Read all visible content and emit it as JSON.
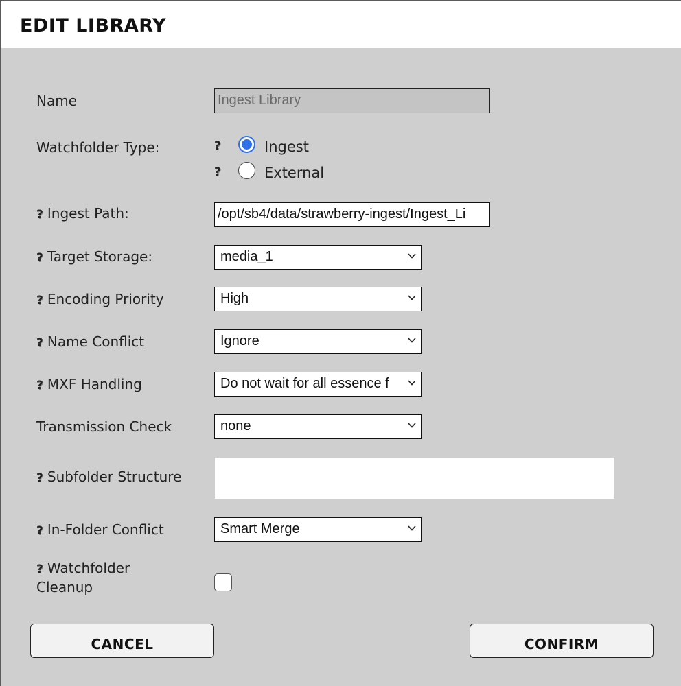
{
  "dialog": {
    "title": "EDIT LIBRARY",
    "help_glyph": "?"
  },
  "fields": {
    "name": {
      "label": "Name",
      "value": "Ingest Library"
    },
    "watchfolder_type": {
      "label": "Watchfolder Type:",
      "options": [
        {
          "label": "Ingest",
          "checked": true
        },
        {
          "label": "External",
          "checked": false
        }
      ]
    },
    "ingest_path": {
      "label": "Ingest Path:",
      "value": "/opt/sb4/data/strawberry-ingest/Ingest_Li"
    },
    "target_storage": {
      "label": "Target Storage:",
      "value": "media_1"
    },
    "encoding_priority": {
      "label": "Encoding Priority",
      "value": "High"
    },
    "name_conflict": {
      "label": "Name Conflict",
      "value": "Ignore"
    },
    "mxf_handling": {
      "label": "MXF Handling",
      "value": "Do not wait for all essence f"
    },
    "transmission_check": {
      "label": "Transmission Check",
      "value": "none"
    },
    "subfolder_structure": {
      "label": "Subfolder Structure",
      "value": ""
    },
    "in_folder_conflict": {
      "label": "In-Folder Conflict",
      "value": "Smart Merge"
    },
    "watchfolder_cleanup": {
      "label_line1": "Watchfolder",
      "label_line2": "Cleanup",
      "checked": false
    }
  },
  "buttons": {
    "cancel": "CANCEL",
    "confirm": "CONFIRM"
  },
  "colors": {
    "accent": "#2f6fe8",
    "background": "#cfcfcf",
    "titlebar": "#ffffff"
  },
  "icons": {
    "help": "question-mark-icon",
    "dropdown": "chevron-down-icon"
  }
}
